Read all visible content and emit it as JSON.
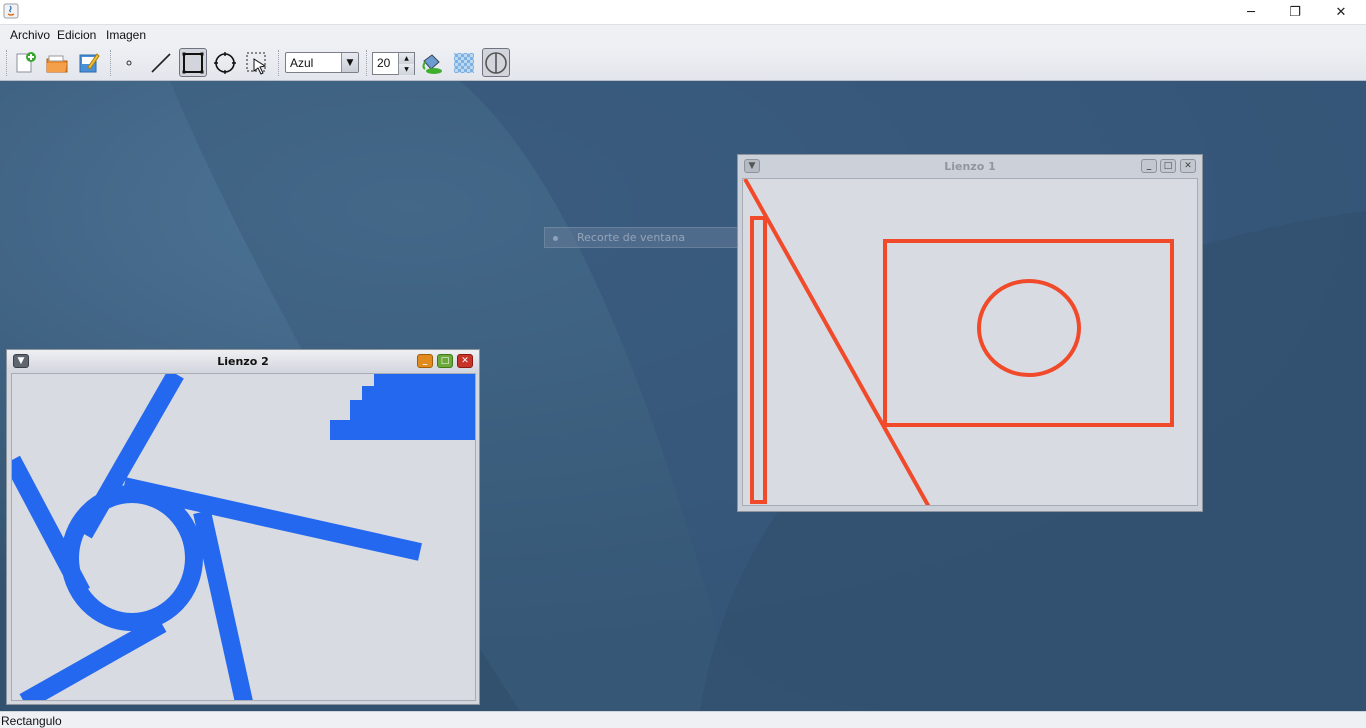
{
  "window": {
    "controls": {
      "minimize": "─",
      "restore": "❐",
      "close": "✕"
    }
  },
  "menu": [
    "Archivo",
    "Edicion",
    "Imagen"
  ],
  "toolbar": {
    "color_select": {
      "value": "Azul"
    },
    "stroke_spinner": {
      "value": "20"
    },
    "selected_tool": "rectangle-tool"
  },
  "ghost": {
    "label": "Recorte de ventana"
  },
  "frames": {
    "lienzo1": {
      "title": "Lienzo 1",
      "stroke_color": "#f04a2b"
    },
    "lienzo2": {
      "title": "Lienzo 2",
      "stroke_color": "#2468ef"
    }
  },
  "status": {
    "text": "Rectangulo"
  },
  "colors": {
    "desktop": "#3d5f80",
    "canvas": "#d9dbe2",
    "accent_blue": "#2468ef",
    "accent_red": "#f04a2b"
  }
}
